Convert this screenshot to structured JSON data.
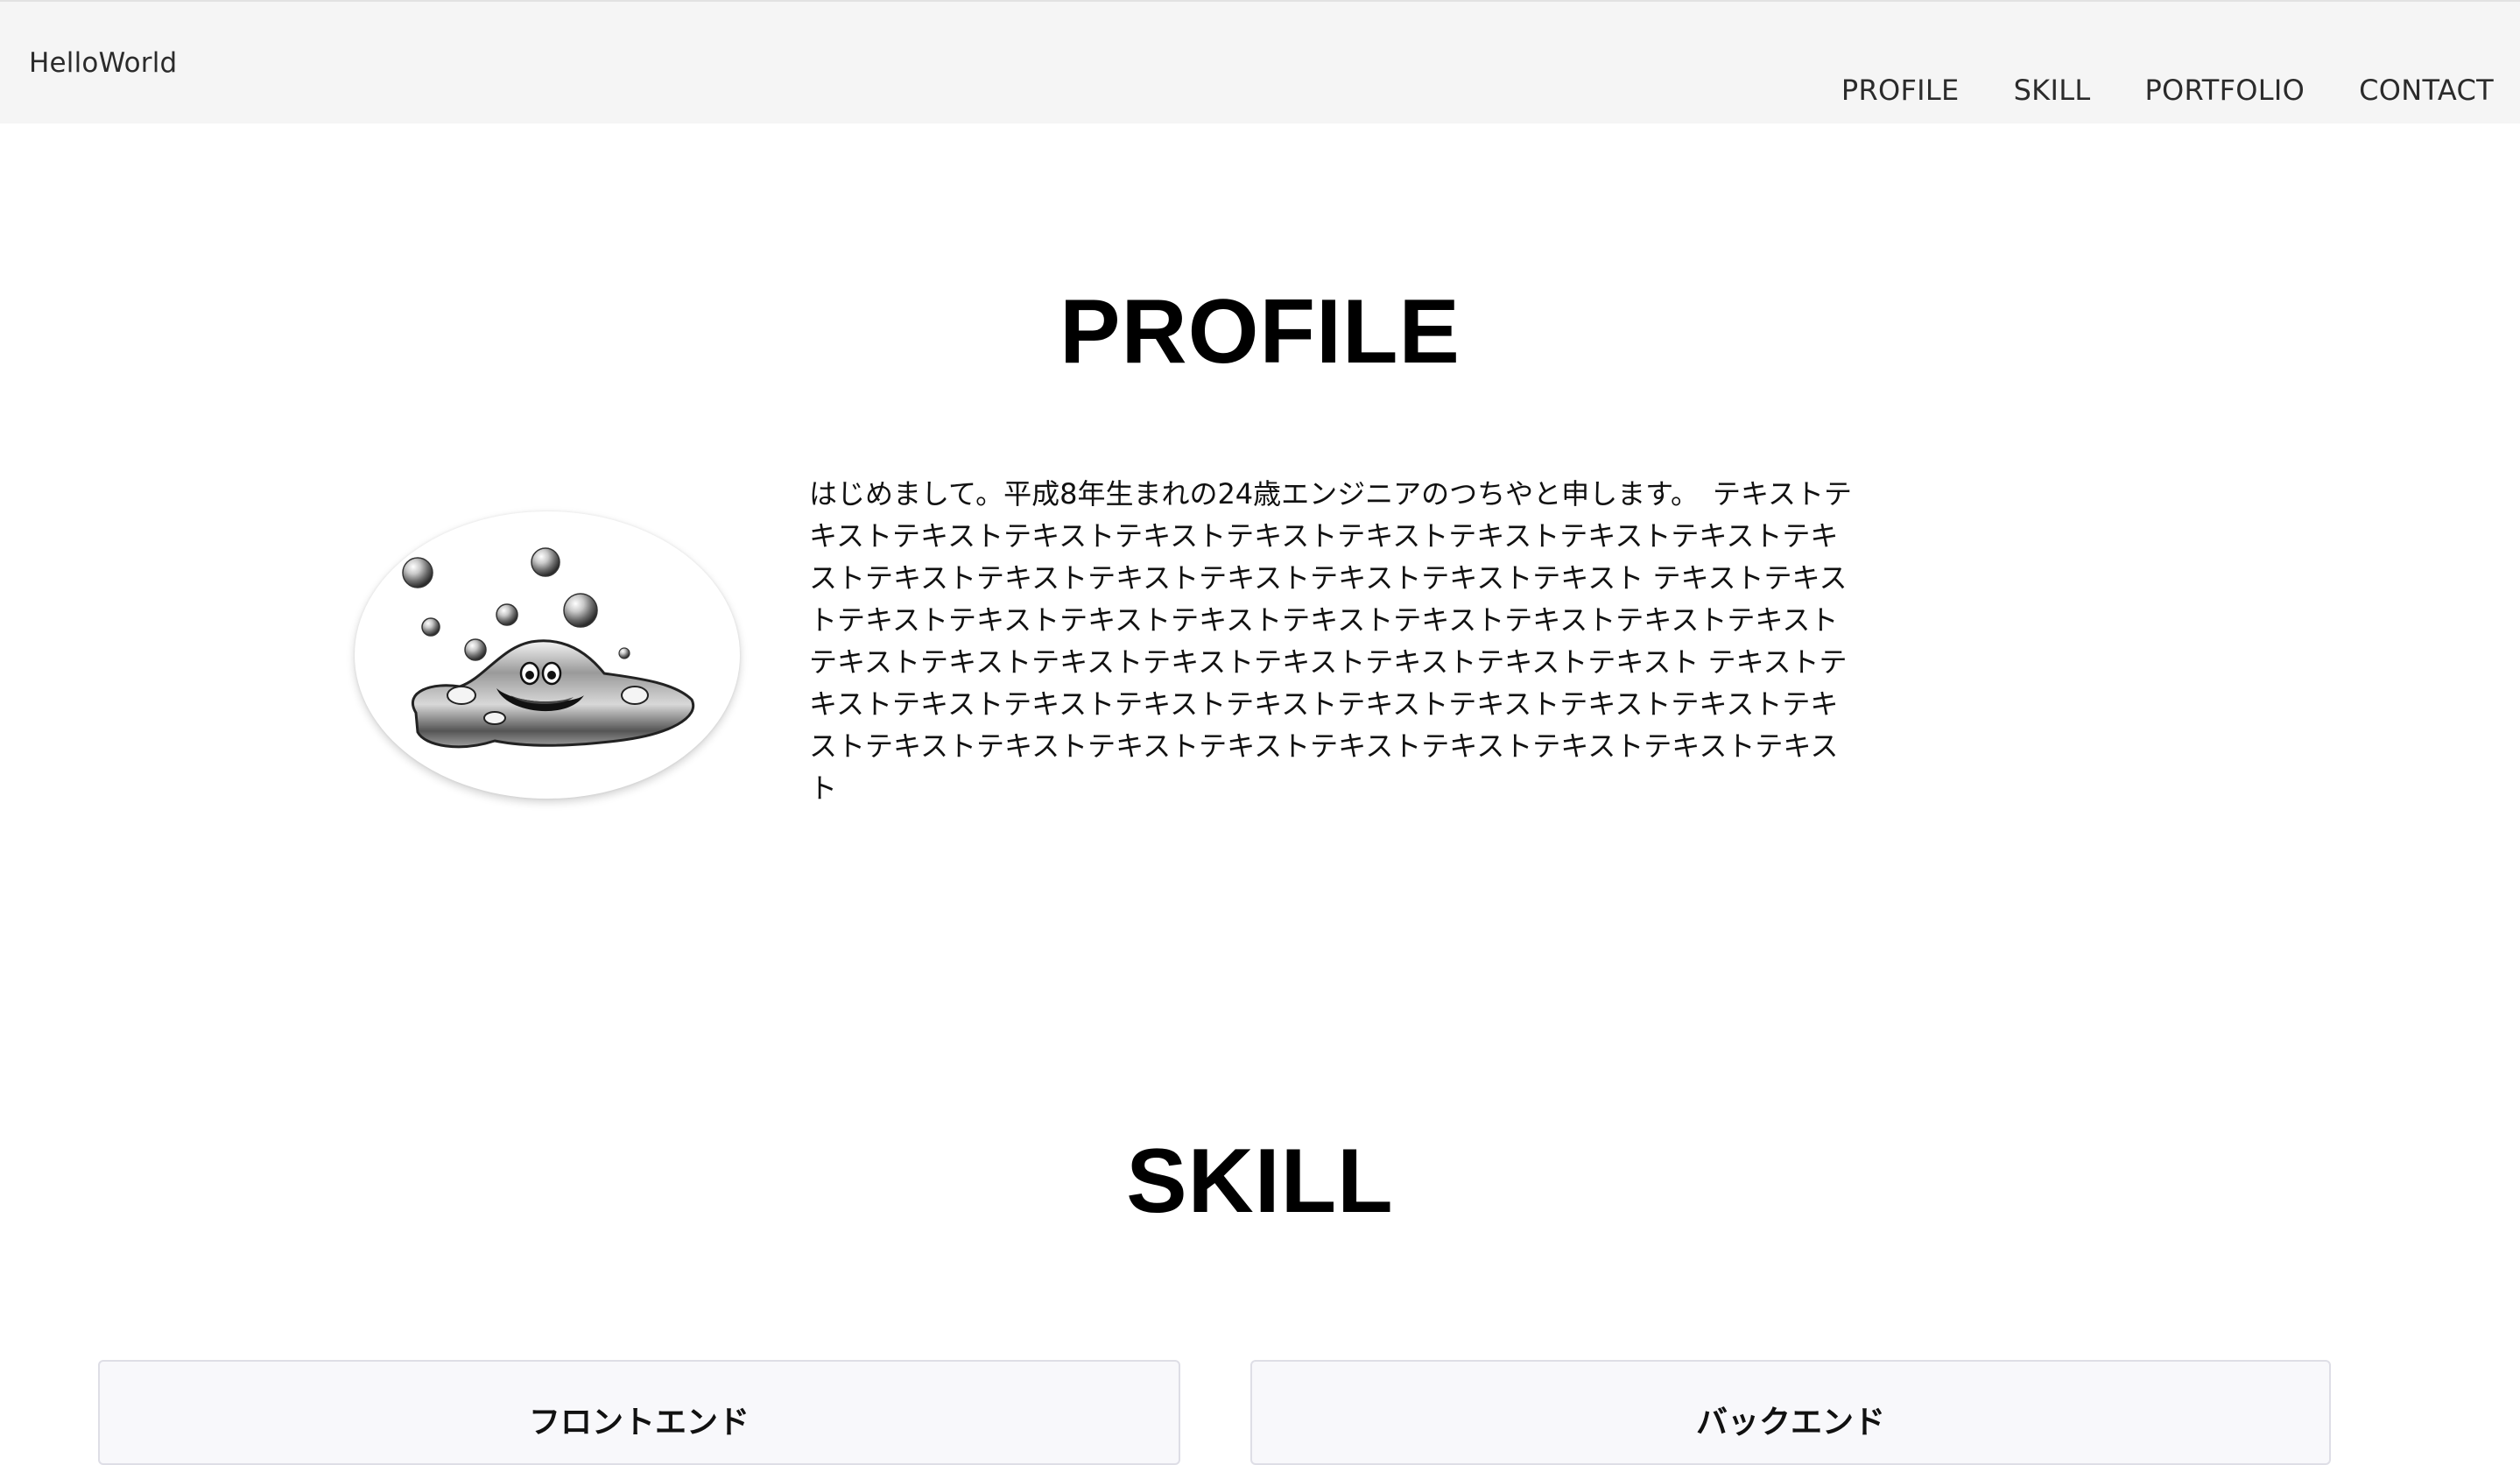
{
  "header": {
    "brand": "HelloWorld",
    "nav": [
      "PROFILE",
      "SKILL",
      "PORTFOLIO",
      "CONTACT"
    ]
  },
  "profile": {
    "title": "PROFILE",
    "avatar_icon": "metal-slime-icon",
    "text": "はじめまして。平成8年生まれの24歳エンジニアのつちやと申します。　テキストテキストテキストテキストテキストテキストテキストテキストテキストテキストテキストテキストテキストテキストテキストテキストテキストテキスト テキストテキストテキストテキストテキストテキストテキストテキストテキストテキストテキストテキストテキストテキストテキストテキストテキストテキストテキスト テキストテキストテキストテキストテキストテキストテキストテキストテキストテキストテキストテキストテキストテキストテキストテキストテキストテキストテキストテキスト"
  },
  "skill": {
    "title": "SKILL",
    "cards": [
      "フロントエンド",
      "バックエンド"
    ]
  },
  "colors": {
    "header_bg": "#f5f5f5",
    "card_bg": "#f8f8fb",
    "text": "#111111"
  }
}
